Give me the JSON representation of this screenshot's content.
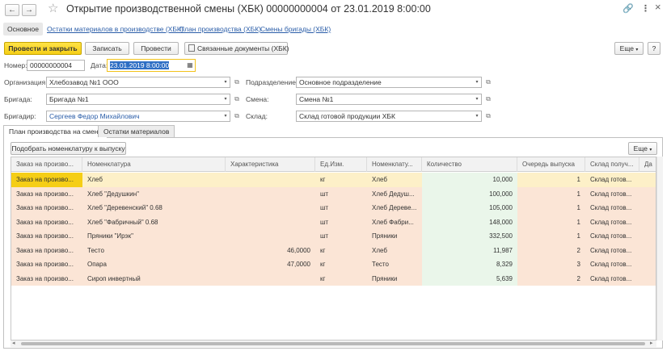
{
  "window": {
    "title": "Открытие производственной смены (ХБК) 00000000004 от 23.01.2019 8:00:00",
    "back_icon": "←",
    "forward_icon": "→",
    "link_icon": "🔗",
    "more_icon": "⋮",
    "close_icon": "×"
  },
  "top_tabs": [
    {
      "label": "Основное"
    },
    {
      "label": "Остатки материалов в производстве (ХБК)"
    },
    {
      "label": "План производства (ХБК)"
    },
    {
      "label": "Смены бригады (ХБК)"
    }
  ],
  "toolbar": {
    "post_close": "Провести и закрыть",
    "save": "Записать",
    "post": "Провести",
    "related": "Связанные документы (ХБК)",
    "more": "Еще",
    "help": "?"
  },
  "header": {
    "number_label": "Номер:",
    "number_value": "00000000004",
    "date_label": "Дата:",
    "date_value": "23.01.2019  8:00:00",
    "org_label": "Организация:",
    "org_value": "Хлебозавод №1 ООО",
    "brigade_label": "Бригада:",
    "brigade_value": "Бригада №1",
    "foreman_label": "Бригадир:",
    "foreman_value": "Сергеев Федор Михайлович",
    "dept_label": "Подразделение:",
    "dept_value": "Основное подразделение",
    "shift_label": "Смена:",
    "shift_value": "Смена №1",
    "warehouse_label": "Склад:",
    "warehouse_value": "Склад готовой продукции ХБК"
  },
  "lower_tabs": [
    {
      "label": "План производства на смену"
    },
    {
      "label": "Остатки материалов"
    }
  ],
  "table_toolbar": {
    "pick": "Подобрать номенклатуру к выпуску",
    "more": "Еще"
  },
  "table": {
    "columns": [
      "Заказ на произво...",
      "Номенклатура",
      "Характеристика",
      "Ед.Изм.",
      "Номенклату...",
      "Количество",
      "Очередь выпуска",
      "Склад получ...",
      "Да"
    ],
    "rows": [
      [
        "Заказ на произво...",
        "Хлеб",
        "",
        "кг",
        "Хлеб",
        "10,000",
        "1",
        "Склад готов..."
      ],
      [
        "Заказ на произво...",
        "Хлеб \"Дедушкин\"",
        "",
        "шт",
        "Хлеб Дедуш...",
        "100,000",
        "1",
        "Склад готов..."
      ],
      [
        "Заказ на произво...",
        "Хлеб \"Деревенский\" 0.68",
        "",
        "шт",
        "Хлеб Деревe...",
        "105,000",
        "1",
        "Склад готов..."
      ],
      [
        "Заказ на произво...",
        "Хлеб \"Фабричный\" 0.68",
        "",
        "шт",
        "Хлеб Фабри...",
        "148,000",
        "1",
        "Склад готов..."
      ],
      [
        "Заказ на произво...",
        "Пряники \"Ирэк\"",
        "",
        "шт",
        "Пряники",
        "332,500",
        "1",
        "Склад готов..."
      ],
      [
        "Заказ на произво...",
        "Тесто",
        "46,0000",
        "кг",
        "Хлеб",
        "11,987",
        "2",
        "Склад готов..."
      ],
      [
        "Заказ на произво...",
        "Опара",
        "47,0000",
        "кг",
        "Тесто",
        "8,329",
        "3",
        "Склад готов..."
      ],
      [
        "Заказ на произво...",
        "Сироп инвертный",
        "",
        "кг",
        "Пряники",
        "5,639",
        "2",
        "Склад готов..."
      ]
    ]
  },
  "colors": {
    "accent_yellow": "#f5ce16",
    "link_blue": "#2a5da8",
    "row_selected": "#fdf0c8",
    "row_normal": "#fbe5d6",
    "qty_cell": "#eaf6ea",
    "date_border": "#f2c21a"
  }
}
